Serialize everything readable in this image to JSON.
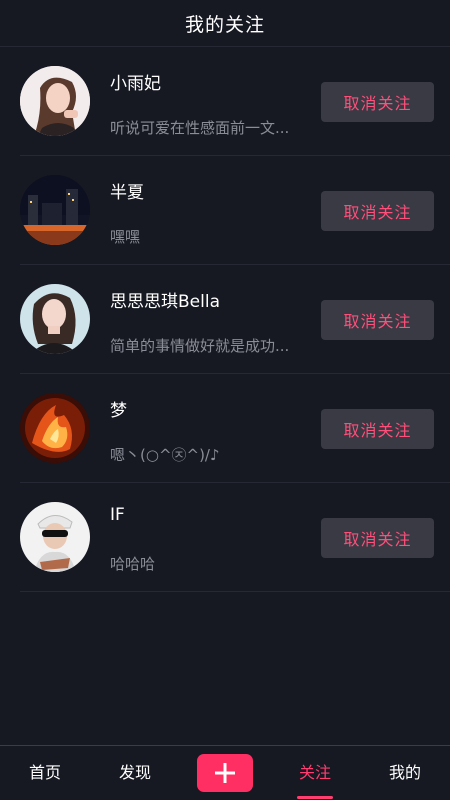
{
  "header": {
    "title": "我的关注"
  },
  "follows": [
    {
      "name": "小雨妃",
      "bio": "听说可爱在性感面前一文...",
      "button": "取消关注",
      "avatar_icon": "girl-portrait-avatar"
    },
    {
      "name": "半夏",
      "bio": "嘿嘿",
      "button": "取消关注",
      "avatar_icon": "city-night-avatar"
    },
    {
      "name": "思思思琪Bella",
      "bio": "简单的事情做好就是成功...",
      "button": "取消关注",
      "avatar_icon": "girl-portrait-avatar"
    },
    {
      "name": "梦",
      "bio": "嗯丶(○^㉨^)/♪",
      "button": "取消关注",
      "avatar_icon": "fire-art-avatar"
    },
    {
      "name": "IF",
      "bio": "哈哈哈",
      "button": "取消关注",
      "avatar_icon": "boy-sunglasses-avatar"
    }
  ],
  "tabbar": {
    "items": [
      "首页",
      "发现",
      "关注",
      "我的"
    ],
    "active": "关注",
    "plus_icon": "plus-icon"
  },
  "colors": {
    "background": "#161822",
    "accent": "#ff3d6e",
    "button_bg": "#393a44",
    "secondary_text": "#8a8c96"
  }
}
